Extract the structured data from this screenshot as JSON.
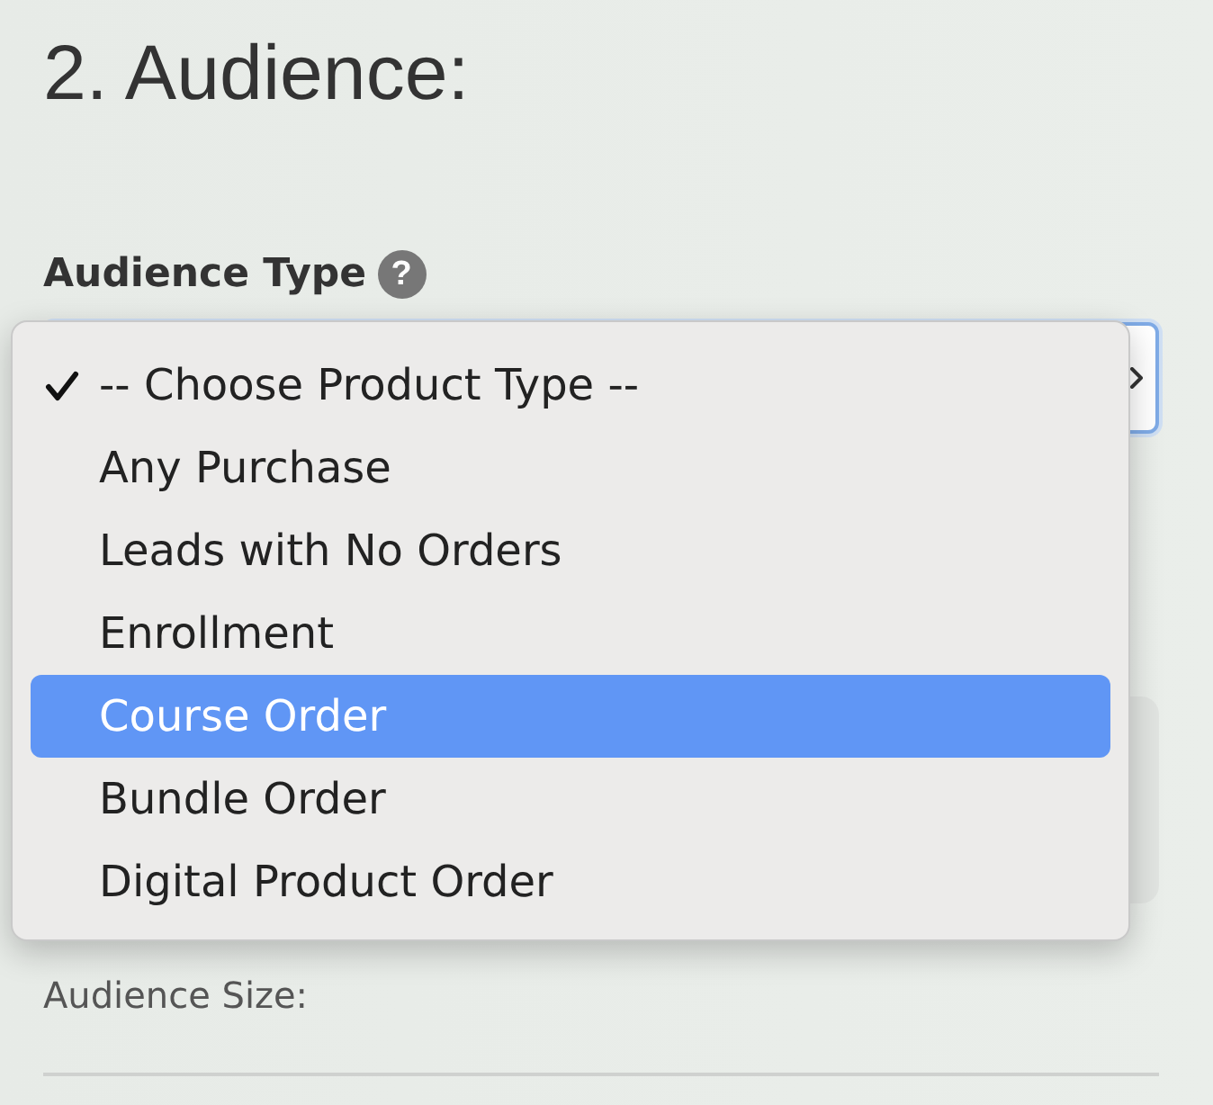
{
  "heading": "2. Audience:",
  "audience_type": {
    "label": "Audience Type",
    "help_icon": "?",
    "select": {
      "focused": true,
      "open": true,
      "options": [
        {
          "label": "-- Choose Product Type --",
          "selected": true,
          "highlighted": false
        },
        {
          "label": "Any Purchase",
          "selected": false,
          "highlighted": false
        },
        {
          "label": "Leads with No Orders",
          "selected": false,
          "highlighted": false
        },
        {
          "label": "Enrollment",
          "selected": false,
          "highlighted": false
        },
        {
          "label": "Course Order",
          "selected": false,
          "highlighted": true
        },
        {
          "label": "Bundle Order",
          "selected": false,
          "highlighted": false
        },
        {
          "label": "Digital Product Order",
          "selected": false,
          "highlighted": false
        }
      ]
    }
  },
  "audience_size": {
    "label": "Audience Size:"
  }
}
